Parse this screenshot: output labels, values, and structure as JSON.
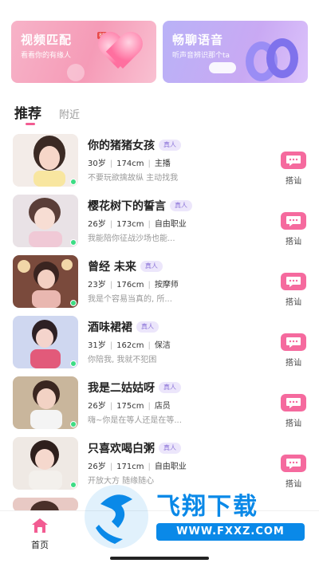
{
  "banners": [
    {
      "title": "视频匹配",
      "subtitle": "看看你的有缘人",
      "badge": "88"
    },
    {
      "title": "畅聊语音",
      "subtitle": "听声音辨识那个ta"
    }
  ],
  "tabs": [
    {
      "label": "推荐",
      "active": true
    },
    {
      "label": "附近",
      "active": false
    }
  ],
  "real_badge": "真人",
  "chat_label": "搭讪",
  "users": [
    {
      "name": "你的猪猪女孩",
      "age": "30岁",
      "height": "174cm",
      "job": "主播",
      "bio": "不要玩欲擒故纵 主动找我"
    },
    {
      "name": "樱花树下的誓言",
      "age": "26岁",
      "height": "173cm",
      "job": "自由职业",
      "bio": "我能陪你征战沙场也能..."
    },
    {
      "name": "曾经 未来",
      "age": "23岁",
      "height": "176cm",
      "job": "按摩师",
      "bio": "我是个容易当真的, 所..."
    },
    {
      "name": "酒味裙裙",
      "age": "31岁",
      "height": "162cm",
      "job": "保洁",
      "bio": "你陪我, 我就不犯困"
    },
    {
      "name": "我是二姑姑呀",
      "age": "26岁",
      "height": "175cm",
      "job": "店员",
      "bio": "嗨~你是在等人还是在等..."
    },
    {
      "name": "只喜欢喝白粥",
      "age": "26岁",
      "height": "171cm",
      "job": "自由职业",
      "bio": "开放大方 随缘随心"
    }
  ],
  "bottom_nav": {
    "home_label": "首页"
  },
  "watermark": {
    "title": "飞翔下载",
    "url": "WWW.FXXZ.COM"
  },
  "colors": {
    "accent": "#f56a9e",
    "badge_bg": "#ece6fb",
    "badge_text": "#8a72d8",
    "online": "#3ddc84",
    "watermark": "#0a89e8"
  }
}
